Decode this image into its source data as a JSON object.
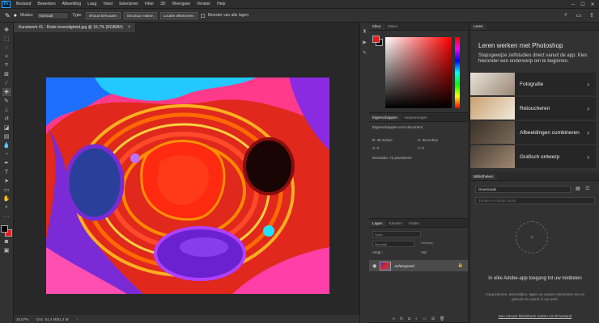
{
  "app": {
    "logo": "Ps"
  },
  "menu": [
    "Bestand",
    "Bewerken",
    "Afbeelding",
    "Laag",
    "Tekst",
    "Selecteren",
    "Filter",
    "3D",
    "Weergave",
    "Venster",
    "Help"
  ],
  "options": {
    "modus_label": "Modus:",
    "modus_value": "Normaal",
    "type_label": "Type:",
    "btn1": "Inhoud behouden",
    "btn2": "Structuur maken",
    "btn3": "Locatie afstemmen",
    "check_label": "Monster van alle lagen"
  },
  "document": {
    "tab_title": "Kunstwerk 41 - Rode levendigheid.jpg @ 16,7% (RGB/8#)",
    "zoom": "16,67%",
    "doc_info": "Doc: 51,4 M/51,4 M"
  },
  "colors": {
    "foreground": "#000000",
    "background": "#e81b1b",
    "picker_fg": "#e81b1b"
  },
  "color_panel": {
    "tabs": [
      "Kleur",
      "Stalen"
    ]
  },
  "properties_panel": {
    "tabs": [
      "Eigenschappen",
      "Aanpassingen"
    ],
    "heading": "Eigenschappen voor document",
    "w": "B: 48 inches",
    "h": "H: 36 inches",
    "x": "X: 0",
    "y": "Y: 0",
    "resolution": "Resolutie: 72 pixels/inch"
  },
  "layers_panel": {
    "tabs": [
      "Lagen",
      "Kanalen",
      "Paden"
    ],
    "search_placeholder": "Soort",
    "mode": "Normaal",
    "opacity": "Dekking:",
    "fill": "Vul:",
    "lock": "Vergr.:",
    "layer_name": "Achtergrond"
  },
  "learn_panel": {
    "tab": "Leren",
    "title": "Leren werken met Photoshop",
    "subtitle": "Stapsgewijze zelfstudies direct vanuit de app. Kies hieronder een onderwerp om te beginnen.",
    "cards": [
      "Fotografie",
      "Retoucheren",
      "Afbeeldingen combineren",
      "Grafisch ontwerp"
    ]
  },
  "libraries_panel": {
    "tab": "Bibliotheken",
    "dropdown": "Downloads",
    "search_placeholder": "Zoeken in Adobe Stock",
    "heading": "In elke Adobe-app toegang tot uw middelen",
    "text": "Voeg kleuren, tekenstijlen, lagen en andere elementen toe en gebruik ze overal in uw werk.",
    "link": "Een nieuwe bibliotheek maken uit dit bestand"
  }
}
